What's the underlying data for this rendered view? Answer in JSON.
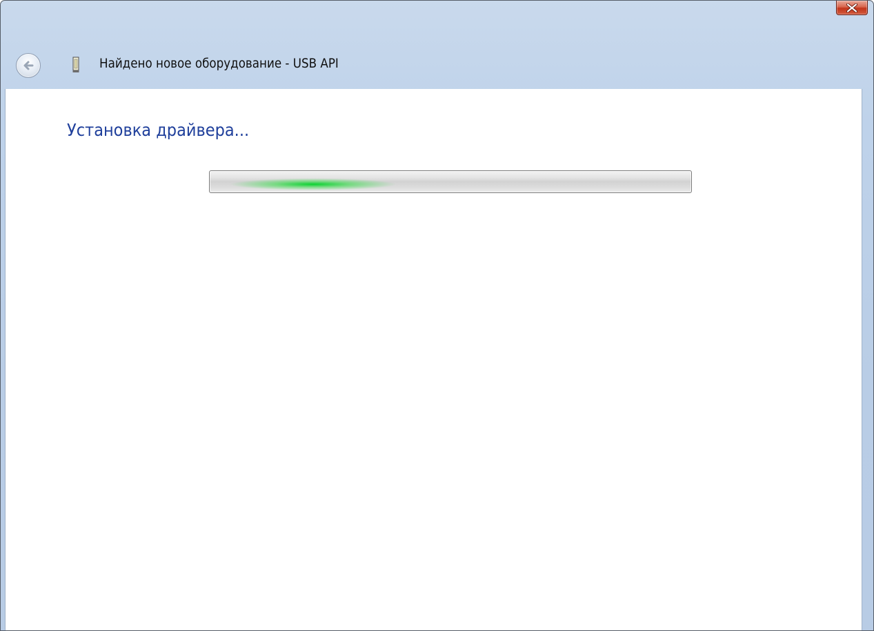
{
  "window": {
    "title": "Найдено новое оборудование - USB API",
    "close_icon": "close-icon",
    "back_icon": "back-arrow-icon",
    "device_icon": "usb-device-icon"
  },
  "content": {
    "heading": "Установка драйвера...",
    "progress": {
      "mode": "indeterminate",
      "accent_color": "#22d23a"
    }
  },
  "colors": {
    "heading": "#1f3f9b",
    "titlebar": "#b9cde6",
    "close_button": "#c2351b"
  }
}
